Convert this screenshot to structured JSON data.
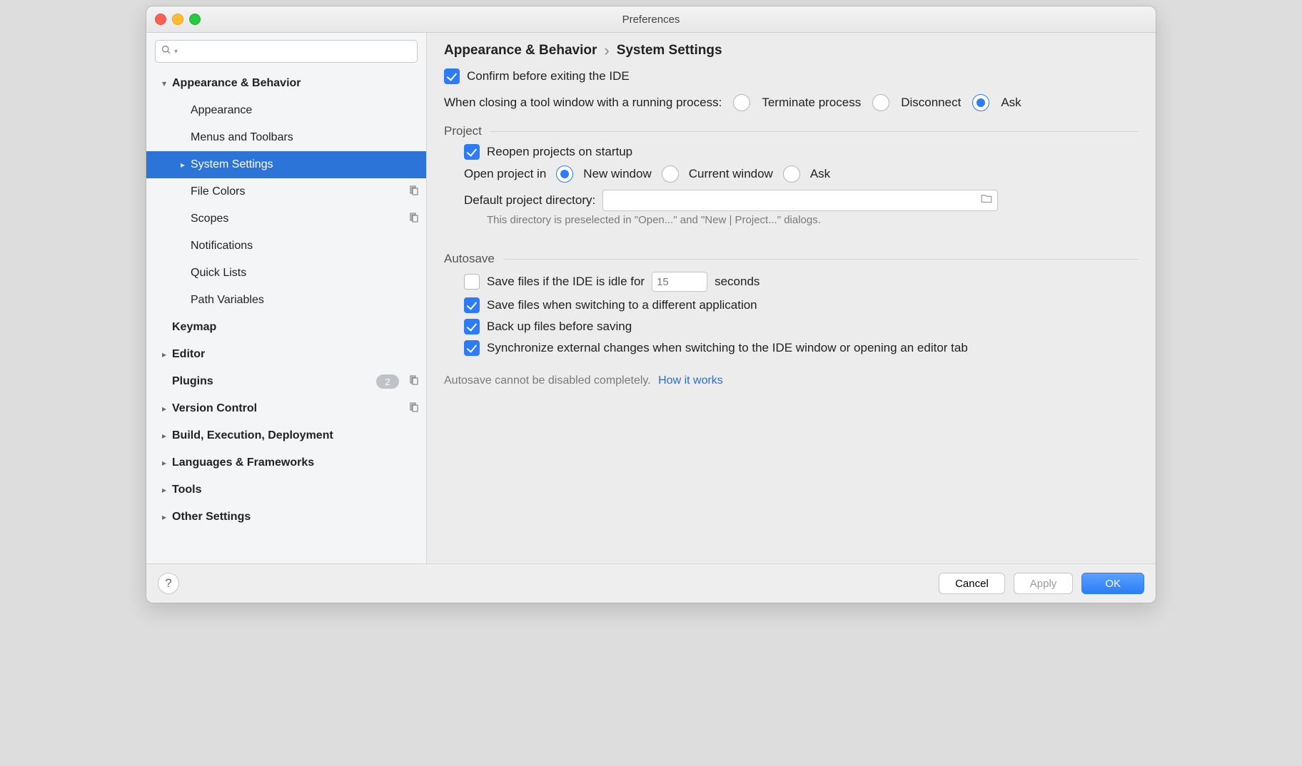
{
  "window": {
    "title": "Preferences"
  },
  "search": {
    "placeholder": ""
  },
  "sidebar": {
    "items": [
      {
        "label": "Appearance & Behavior",
        "level": 0,
        "bold": true,
        "twisty": "down",
        "badge": "",
        "copy": false,
        "selected": false
      },
      {
        "label": "Appearance",
        "level": 1,
        "bold": false,
        "twisty": "",
        "badge": "",
        "copy": false,
        "selected": false
      },
      {
        "label": "Menus and Toolbars",
        "level": 1,
        "bold": false,
        "twisty": "",
        "badge": "",
        "copy": false,
        "selected": false
      },
      {
        "label": "System Settings",
        "level": 1,
        "bold": false,
        "twisty": "right",
        "badge": "",
        "copy": false,
        "selected": true
      },
      {
        "label": "File Colors",
        "level": 1,
        "bold": false,
        "twisty": "",
        "badge": "",
        "copy": true,
        "selected": false
      },
      {
        "label": "Scopes",
        "level": 1,
        "bold": false,
        "twisty": "",
        "badge": "",
        "copy": true,
        "selected": false
      },
      {
        "label": "Notifications",
        "level": 1,
        "bold": false,
        "twisty": "",
        "badge": "",
        "copy": false,
        "selected": false
      },
      {
        "label": "Quick Lists",
        "level": 1,
        "bold": false,
        "twisty": "",
        "badge": "",
        "copy": false,
        "selected": false
      },
      {
        "label": "Path Variables",
        "level": 1,
        "bold": false,
        "twisty": "",
        "badge": "",
        "copy": false,
        "selected": false
      },
      {
        "label": "Keymap",
        "level": 0,
        "bold": true,
        "twisty": "",
        "badge": "",
        "copy": false,
        "selected": false
      },
      {
        "label": "Editor",
        "level": 0,
        "bold": true,
        "twisty": "right",
        "badge": "",
        "copy": false,
        "selected": false
      },
      {
        "label": "Plugins",
        "level": 0,
        "bold": true,
        "twisty": "",
        "badge": "2",
        "copy": true,
        "selected": false
      },
      {
        "label": "Version Control",
        "level": 0,
        "bold": true,
        "twisty": "right",
        "badge": "",
        "copy": true,
        "selected": false
      },
      {
        "label": "Build, Execution, Deployment",
        "level": 0,
        "bold": true,
        "twisty": "right",
        "badge": "",
        "copy": false,
        "selected": false
      },
      {
        "label": "Languages & Frameworks",
        "level": 0,
        "bold": true,
        "twisty": "right",
        "badge": "",
        "copy": false,
        "selected": false
      },
      {
        "label": "Tools",
        "level": 0,
        "bold": true,
        "twisty": "right",
        "badge": "",
        "copy": false,
        "selected": false
      },
      {
        "label": "Other Settings",
        "level": 0,
        "bold": true,
        "twisty": "right",
        "badge": "",
        "copy": false,
        "selected": false
      }
    ]
  },
  "breadcrumb": {
    "root": "Appearance & Behavior",
    "leaf": "System Settings"
  },
  "settings": {
    "confirm_exit": {
      "label": "Confirm before exiting the IDE",
      "checked": true
    },
    "close_tool_window": {
      "label": "When closing a tool window with a running process:",
      "options": [
        "Terminate process",
        "Disconnect",
        "Ask"
      ],
      "selected": "Ask"
    },
    "project": {
      "section": "Project",
      "reopen": {
        "label": "Reopen projects on startup",
        "checked": true
      },
      "open_in": {
        "label": "Open project in",
        "options": [
          "New window",
          "Current window",
          "Ask"
        ],
        "selected": "New window"
      },
      "default_dir": {
        "label": "Default project directory:",
        "value": "",
        "hint": "This directory is preselected in \"Open...\" and \"New | Project...\" dialogs."
      }
    },
    "autosave": {
      "section": "Autosave",
      "idle": {
        "label_prefix": "Save files if the IDE is idle for",
        "value": "15",
        "label_suffix": "seconds",
        "checked": false
      },
      "switch_app": {
        "label": "Save files when switching to a different application",
        "checked": true
      },
      "backup": {
        "label": "Back up files before saving",
        "checked": true
      },
      "sync": {
        "label": "Synchronize external changes when switching to the IDE window or opening an editor tab",
        "checked": true
      },
      "note": "Autosave cannot be disabled completely.",
      "note_link": "How it works"
    }
  },
  "footer": {
    "help": "?",
    "cancel": "Cancel",
    "apply": "Apply",
    "ok": "OK"
  }
}
